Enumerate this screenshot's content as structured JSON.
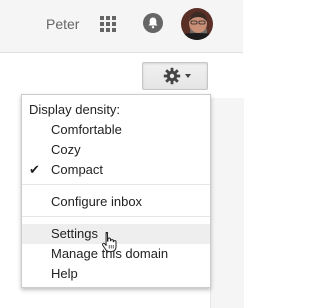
{
  "header": {
    "user_name": "Peter",
    "apps_icon": "apps-grid-icon",
    "notifications_icon": "bell-icon",
    "avatar_icon": "avatar"
  },
  "settings_button": {
    "icon": "gear-icon",
    "dropdown_icon": "caret-down-icon"
  },
  "menu": {
    "density_header": "Display density:",
    "density_options": [
      {
        "label": "Comfortable",
        "checked": false
      },
      {
        "label": "Cozy",
        "checked": false
      },
      {
        "label": "Compact",
        "checked": true
      }
    ],
    "checkmark_glyph": "✔",
    "configure_inbox": "Configure inbox",
    "settings": "Settings",
    "manage_domain": "Manage this domain",
    "help": "Help"
  },
  "colors": {
    "accent_gray": "#f5f5f5",
    "hover_row": "#eeeeee",
    "text": "#222222"
  }
}
